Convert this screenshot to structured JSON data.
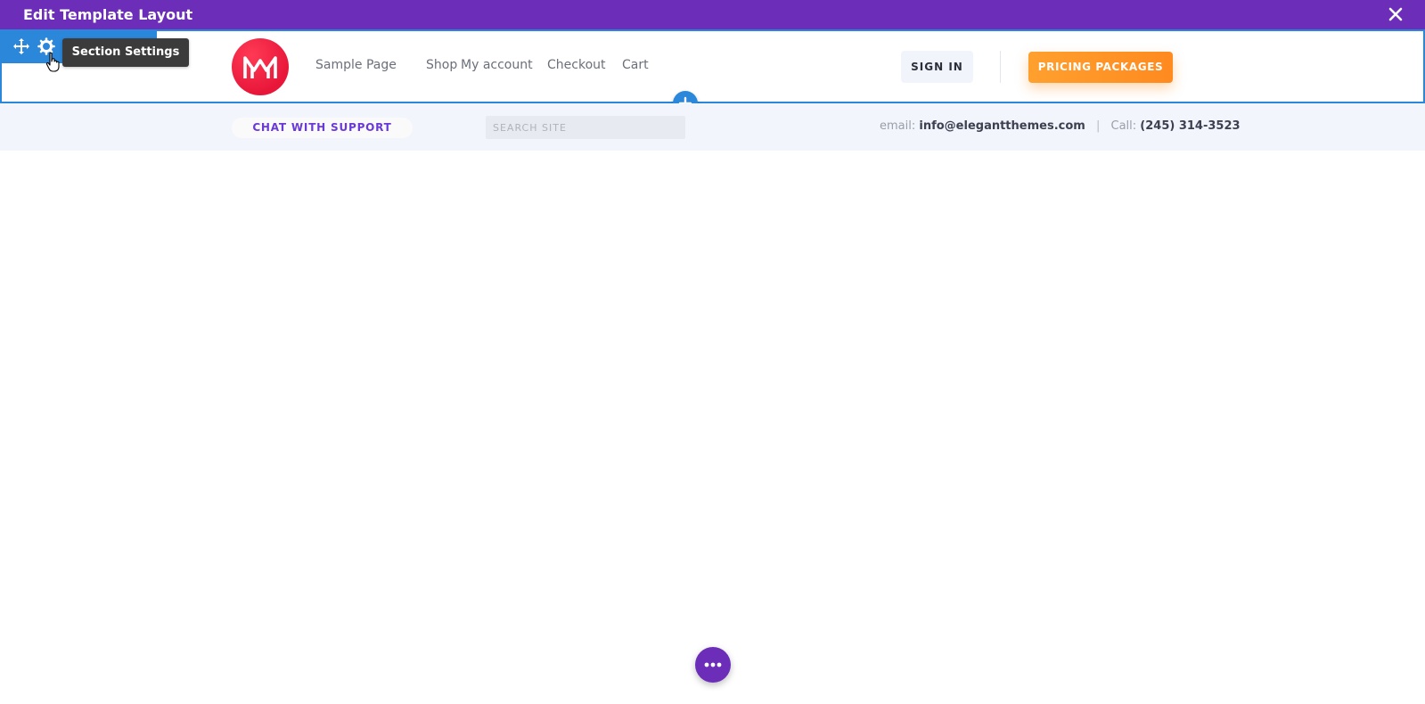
{
  "topbar": {
    "title": "Edit Template Layout"
  },
  "section_toolbar": {
    "tooltip": "Section Settings",
    "icons": [
      "move-icon",
      "gear-icon",
      "layout-icon",
      "power-icon",
      "trash-icon"
    ]
  },
  "nav": {
    "items": [
      "Sample Page",
      "Shop",
      "My account",
      "Checkout",
      "Cart"
    ]
  },
  "header_buttons": {
    "signin": "SIGN IN",
    "pricing": "PRICING PACKAGES"
  },
  "subbar": {
    "chat": "CHAT WITH SUPPORT",
    "search_placeholder": "SEARCH SITE",
    "email_label": "email:",
    "email_value": "info@elegantthemes.com",
    "call_label": "Call:",
    "call_value": "(245) 314-3523",
    "separator": "|"
  },
  "colors": {
    "builder_purple": "#6c2eb9",
    "selection_blue": "#2b87da",
    "accent_orange": "#ff9a28",
    "logo_red": "#ef1f45"
  }
}
